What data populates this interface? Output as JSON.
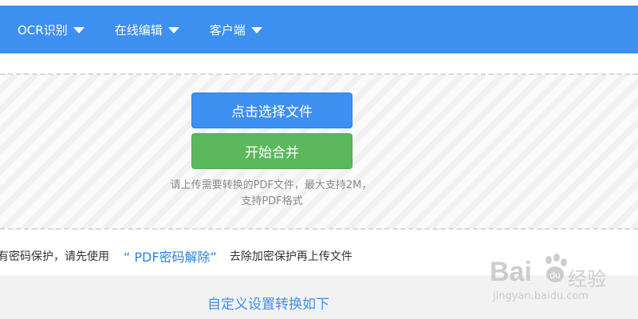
{
  "nav": {
    "items": [
      {
        "label": "OCR识别",
        "icon": "caret-down-icon"
      },
      {
        "label": "在线编辑",
        "icon": "caret-down-icon"
      },
      {
        "label": "客户端",
        "icon": "caret-down-icon"
      }
    ]
  },
  "upload": {
    "select_button": "点击选择文件",
    "merge_button": "开始合并",
    "hint_line1": "请上传需要转换的PDF文件，最大支持2M，",
    "hint_line2": "支持PDF格式"
  },
  "notice": {
    "prefix": "有密码保护，请先使用",
    "link": "“ PDF密码解除”",
    "suffix": "去除加密保护再上传文件"
  },
  "bottom": {
    "custom_settings_link": "自定义设置转换如下"
  },
  "watermark": {
    "logo": "Bai",
    "text": "经验",
    "url": "jingyan.baidu.com"
  },
  "colors": {
    "nav_bg": "#3d8ff0",
    "select_button": "#3d8ff0",
    "merge_button": "#5cb85c",
    "link": "#2f7fd8"
  }
}
